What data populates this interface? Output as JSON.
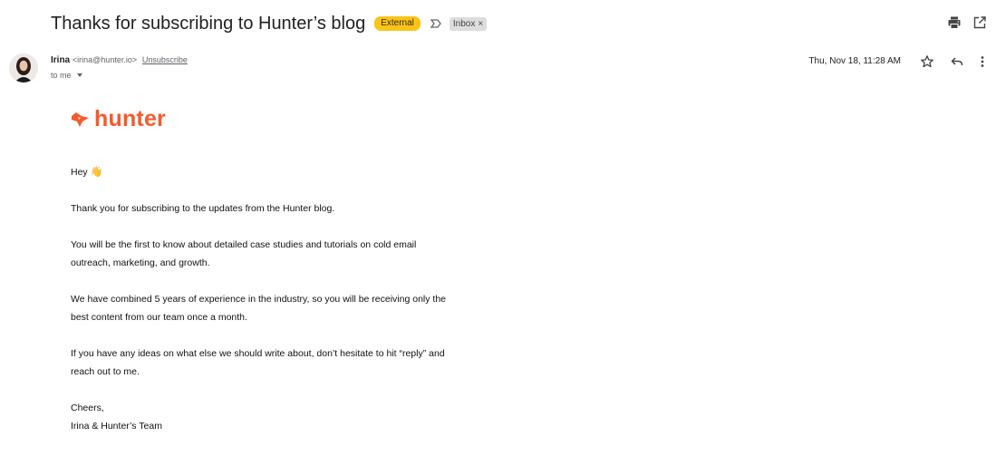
{
  "subject": {
    "title": "Thanks for subscribing to Hunter’s blog",
    "external_badge": "External",
    "label": "Inbox",
    "label_close": "×"
  },
  "top_actions": {
    "icons": [
      "print-icon",
      "open-in-new-window-icon"
    ]
  },
  "sender": {
    "name": "Irina",
    "email": "<irina@hunter.io>",
    "unsubscribe": "Unsubscribe",
    "to": "to me",
    "date": "Thu, Nov 18, 11:28 AM",
    "avatar": "avatar-photo"
  },
  "header_actions": {
    "icons": [
      "star-icon",
      "reply-icon",
      "more-vert-icon"
    ]
  },
  "body": {
    "logo_text": "hunter",
    "greeting": "Hey",
    "greeting_emoji": "👋",
    "p1": "Thank you for subscribing to the updates from the Hunter blog.",
    "p2_line1": "You will be the first to know about detailed case studies and tutorials on cold email",
    "p2_line2": "outreach, marketing, and growth.",
    "p3_line1": "We have combined 5 years of experience in the industry, so you will be receiving only the",
    "p3_line2": "best content from our team once a month.",
    "p4_line1": "If you have any ideas on what else we should write about, don’t hesitate to hit “reply” and",
    "p4_line2": "reach out to me.",
    "signoff": "Cheers,",
    "signature": "Irina & Hunter’s Team"
  },
  "colors": {
    "brand": "#f55b2c",
    "external_badge": "#f9c419"
  }
}
